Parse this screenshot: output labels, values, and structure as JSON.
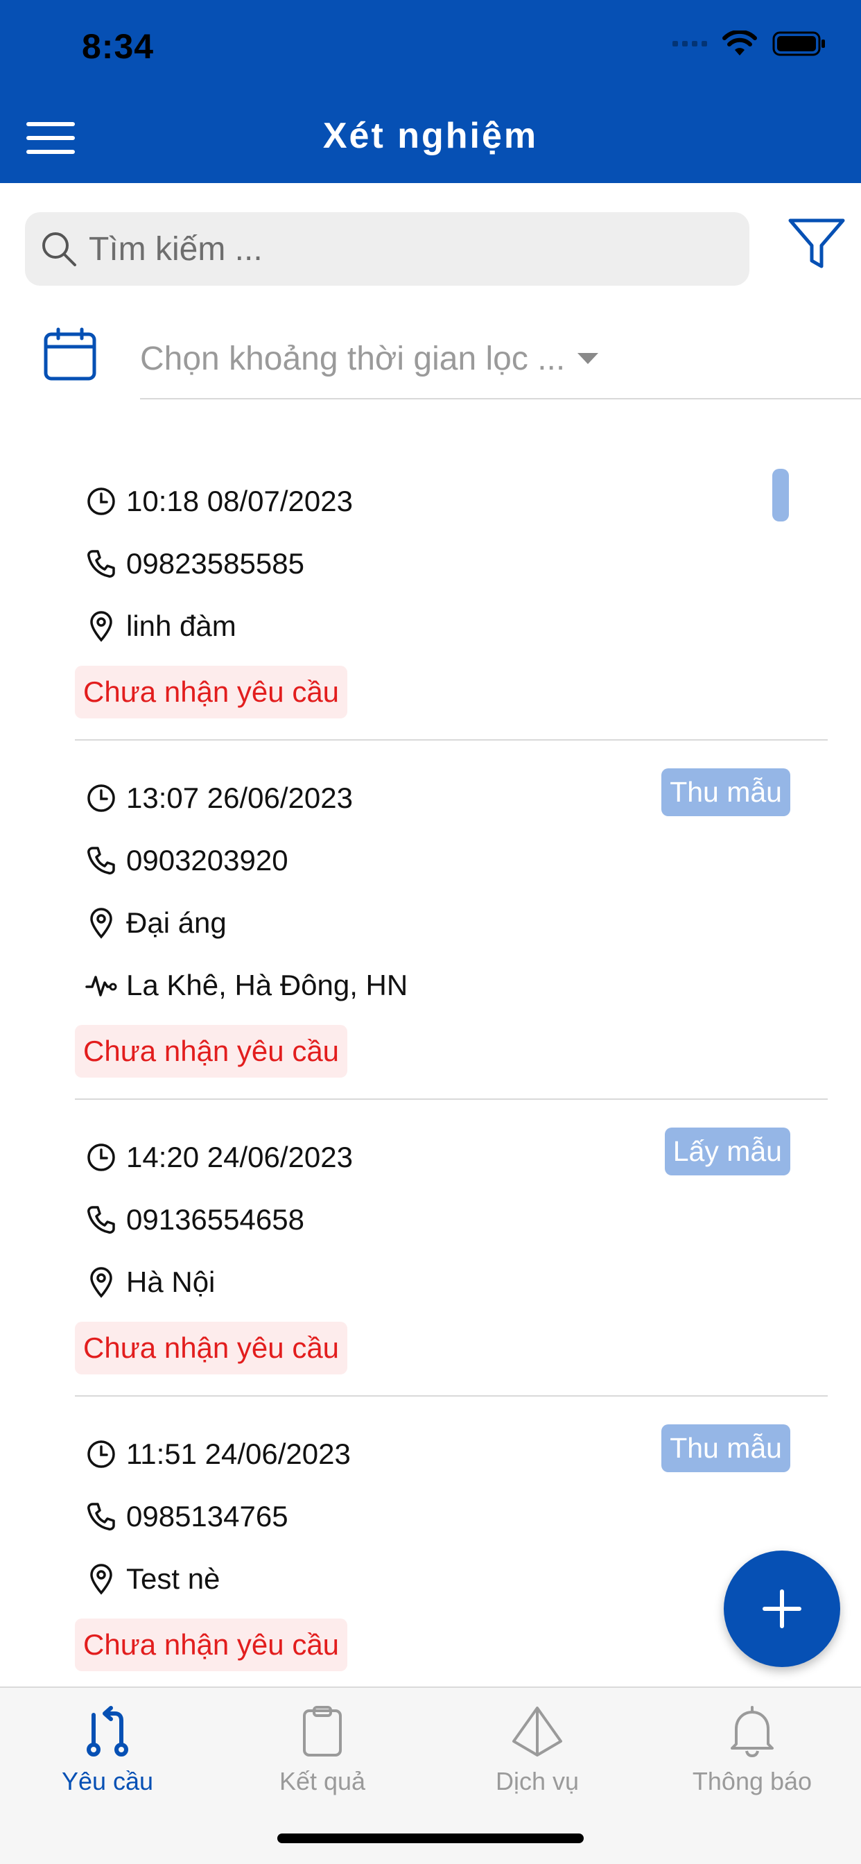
{
  "status_bar": {
    "time": "8:34"
  },
  "header": {
    "title": "Xét nghiệm"
  },
  "search": {
    "placeholder": "Tìm kiếm ..."
  },
  "date_filter": {
    "placeholder": "Chọn khoảng thời gian lọc ..."
  },
  "requests": [
    {
      "time": "10:18 08/07/2023",
      "phone": "09823585585",
      "location": "linh đàm",
      "status": "Chưa nhận yêu cầu"
    },
    {
      "time": "13:07 26/06/2023",
      "phone": "0903203920",
      "location": "Đại áng",
      "service_location": "La Khê, Hà Đông, HN",
      "tag": "Thu mẫu",
      "status": "Chưa nhận yêu cầu"
    },
    {
      "time": "14:20 24/06/2023",
      "phone": "09136554658",
      "location": "Hà Nội",
      "tag": "Lấy mẫu",
      "status": "Chưa nhận yêu cầu"
    },
    {
      "time": "11:51 24/06/2023",
      "phone": "0985134765",
      "location": "Test nè",
      "tag": "Thu mẫu",
      "status": "Chưa nhận yêu cầu"
    }
  ],
  "tabs": [
    {
      "label": "Yêu cầu",
      "icon": "pull-request-icon",
      "active": true
    },
    {
      "label": "Kết quả",
      "icon": "clipboard-icon",
      "active": false
    },
    {
      "label": "Dịch vụ",
      "icon": "prism-icon",
      "active": false
    },
    {
      "label": "Thông báo",
      "icon": "bell-icon",
      "active": false
    }
  ],
  "colors": {
    "primary": "#0650B4",
    "status_text": "#E21D1D",
    "status_bg": "#FDECEC",
    "tag_bg": "#95B6E6"
  }
}
